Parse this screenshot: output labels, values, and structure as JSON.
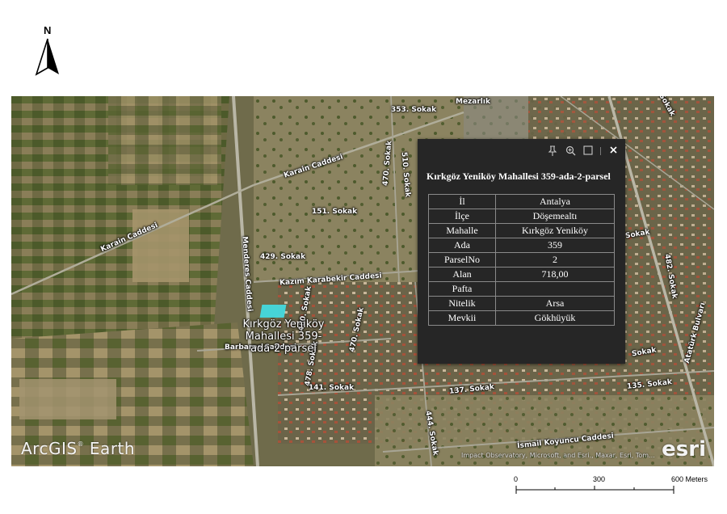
{
  "north_arrow": {
    "letter": "N"
  },
  "map": {
    "road_labels": [
      "353. Sokak",
      "Mezarlık",
      "Karain Caddesi",
      "470. Sokak",
      "510. Sokak",
      "151. Sokak",
      "Karain Caddesi",
      "Menderes Caddesi",
      "429. Sokak",
      "Kazım Karabekir Caddesi",
      "480. Sokak",
      "470. Sokak",
      "Barbaros Caddesi",
      "478. Sokak",
      "141. Sokak",
      "137. Sokak",
      "135. Sokak",
      "444. Sokak",
      "İsmail Koyuncu Caddesi",
      "Atatürk Bulvarı",
      "482. Sokak",
      "Sokak",
      "Sokak",
      "Sokak"
    ],
    "parcel_label": "Kırkgöz Yeniköy Mahallesi 359-ada-2-parsel",
    "logo_text": "ArcGIS",
    "logo_text2": "Earth",
    "logo_reg": "®",
    "esri_text": "esri",
    "attribution": "Impact Observatory, Microsoft, and Esri., Maxar, Esri, Tom..."
  },
  "popup": {
    "title": "Kırkgöz Yeniköy Mahallesi 359-ada-2-parsel",
    "rows": [
      {
        "key": "İl",
        "value": "Antalya"
      },
      {
        "key": "İlçe",
        "value": "Döşemealtı"
      },
      {
        "key": "Mahalle",
        "value": "Kırkgöz Yeniköy"
      },
      {
        "key": "Ada",
        "value": "359"
      },
      {
        "key": "ParselNo",
        "value": "2"
      },
      {
        "key": "Alan",
        "value": "718,00"
      },
      {
        "key": "Pafta",
        "value": ""
      },
      {
        "key": "Nitelik",
        "value": "Arsa"
      },
      {
        "key": "Mevkii",
        "value": "Gökhüyük"
      }
    ],
    "tool_icons": [
      "pin-icon",
      "zoom-to-icon",
      "dock-icon",
      "close-icon"
    ]
  },
  "scale_bar": {
    "labels": [
      "0",
      "300",
      "600 Meters"
    ]
  }
}
